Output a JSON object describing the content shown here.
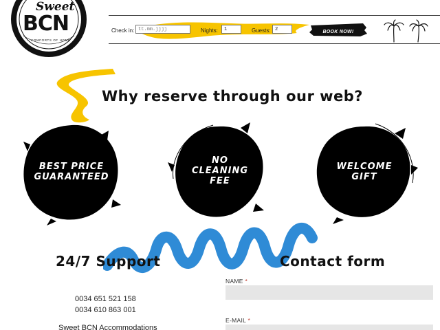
{
  "brand": {
    "logo_script": "Sweet",
    "logo_main": "BCN",
    "logo_tagline": "COMFORTS OF HOME"
  },
  "booking": {
    "checkin_label": "Check in:",
    "checkin_placeholder": "tt.mm.jjjj",
    "nights_label": "Nights:",
    "nights_value": "1",
    "guests_label": "Guests:",
    "guests_value": "2",
    "book_button": "BOOK NOW!"
  },
  "why": {
    "title": "Why reserve through our web?",
    "features": [
      {
        "label": "BEST PRICE GUARANTEED"
      },
      {
        "label": "NO CLEANING FEE"
      },
      {
        "label": "WELCOME GIFT"
      }
    ]
  },
  "support": {
    "title": "24/7 Support",
    "phones": [
      "0034 651 521 158",
      "0034 610 863 001"
    ],
    "company": "Sweet BCN Accommodations"
  },
  "contact": {
    "title": "Contact form",
    "name_label": "NAME",
    "email_label": "E-MAIL",
    "required_mark": "*"
  },
  "colors": {
    "accent_yellow": "#f7c400",
    "accent_blue": "#2f8bd6",
    "ink": "#000000",
    "field_bg": "#e6e6e6"
  }
}
